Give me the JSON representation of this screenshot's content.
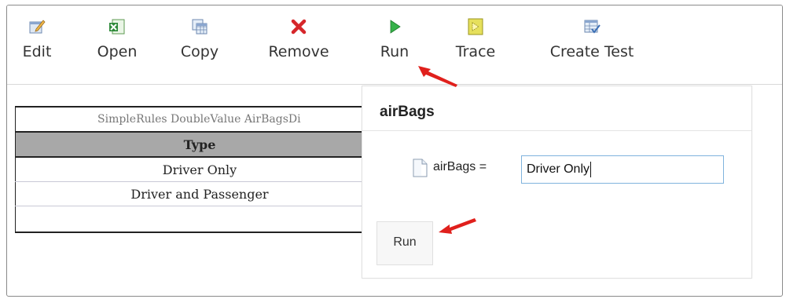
{
  "toolbar": {
    "edit_label": "Edit",
    "open_label": "Open",
    "copy_label": "Copy",
    "remove_label": "Remove",
    "run_label": "Run",
    "trace_label": "Trace",
    "create_test_label": "Create Test"
  },
  "table": {
    "title": "SimpleRules DoubleValue AirBagsDi",
    "header": "Type",
    "rows": [
      "Driver Only",
      "Driver and Passenger",
      ""
    ]
  },
  "popup": {
    "title": "airBags",
    "param_label": "airBags =",
    "param_value": "Driver Only",
    "run_button": "Run"
  },
  "colors": {
    "accent_input_border": "#7fb3dd",
    "header_bg": "#a8a8a8",
    "arrow": "#e0201c"
  }
}
